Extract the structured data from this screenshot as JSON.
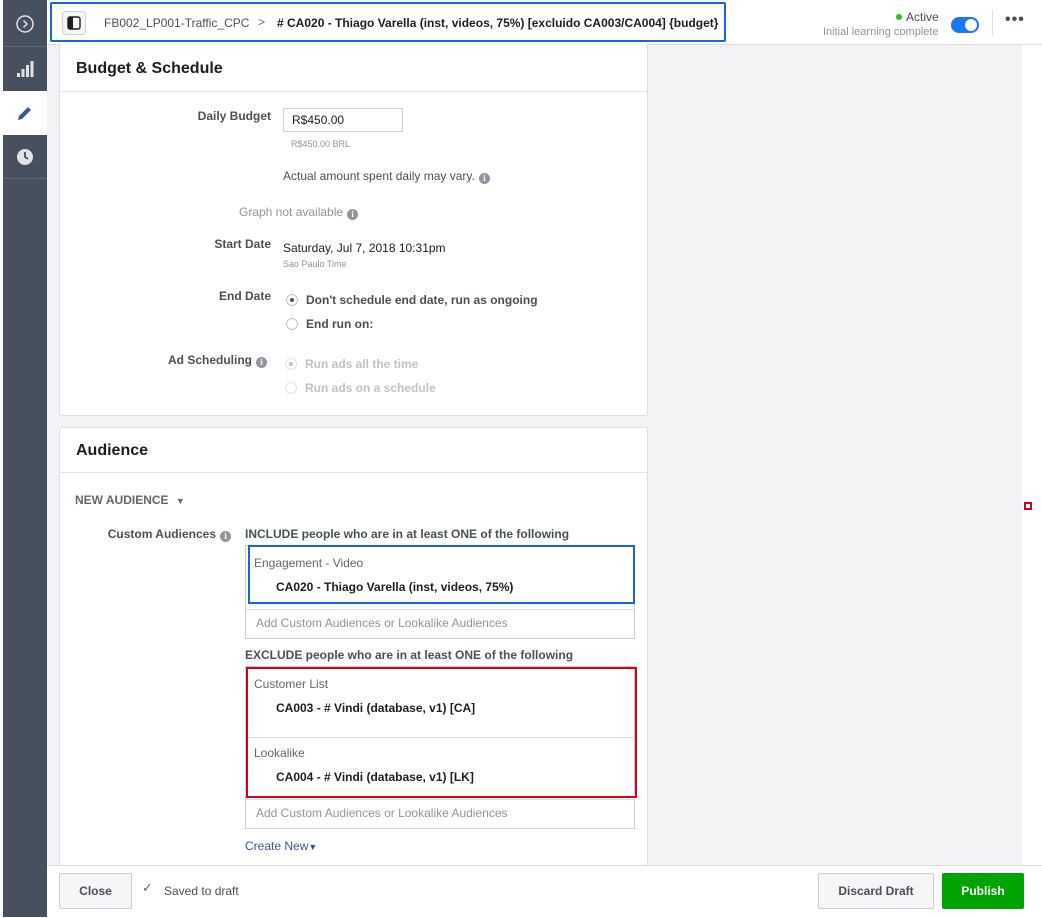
{
  "topbar": {
    "campaign": "FB002_LP001-Traffic_CPC",
    "chevron": ">",
    "adset": "# CA020 - Thiago Varella (inst, videos, 75%) [excluido CA003/CA004] {budget}",
    "status": "Active",
    "status_sub": "Initial learning complete",
    "more": "•••"
  },
  "budget": {
    "title": "Budget & Schedule",
    "daily_budget_label": "Daily Budget",
    "daily_budget_value": "R$450.00",
    "daily_budget_sub": "R$450.00 BRL",
    "actual_note": "Actual amount spent daily may vary.",
    "graph_note": "Graph not available",
    "start_date_label": "Start Date",
    "start_date_value": "Saturday, Jul 7, 2018 10:31pm",
    "timezone": "Sao Paulo Time",
    "end_date_label": "End Date",
    "end_opt1": "Don't schedule end date, run as ongoing",
    "end_opt2": "End run on:",
    "sched_label": "Ad Scheduling",
    "sched_opt1": "Run ads all the time",
    "sched_opt2": "Run ads on a schedule"
  },
  "audience": {
    "title": "Audience",
    "new_audience": "NEW AUDIENCE",
    "custom_label": "Custom Audiences",
    "include_text": "INCLUDE people who are in at least ONE of the following",
    "include_category": "Engagement - Video",
    "include_item": "CA020 - Thiago Varella (inst, videos, 75%)",
    "placeholder": "Add Custom Audiences or Lookalike Audiences",
    "exclude_text": "EXCLUDE people who are in at least ONE of the following",
    "exclude_cat1": "Customer List",
    "exclude_item1": "CA003 - # Vindi (database, v1) [CA]",
    "exclude_cat2": "Lookalike",
    "exclude_item2": "CA004 - # Vindi (database, v1) [LK]",
    "create_new": "Create New"
  },
  "footer": {
    "close": "Close",
    "saved": "Saved to draft",
    "discard": "Discard Draft",
    "publish": "Publish"
  },
  "colors": {
    "highlight_blue": "#1a64d6",
    "highlight_red": "#d0021b",
    "publish_green": "#00a400",
    "rail": "#46505f"
  }
}
